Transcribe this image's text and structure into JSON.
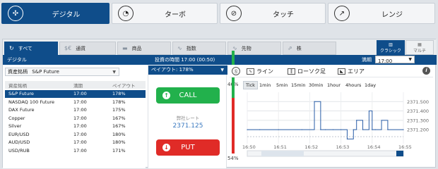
{
  "top_tabs": [
    {
      "label": "デジタル",
      "icon": "digital-icon",
      "active": true
    },
    {
      "label": "ターボ",
      "icon": "turbo-icon",
      "active": false
    },
    {
      "label": "タッチ",
      "icon": "touch-icon",
      "active": false
    },
    {
      "label": "レンジ",
      "icon": "range-icon",
      "active": false
    }
  ],
  "category_tabs": [
    {
      "label": "すべて",
      "icon": "refresh-icon",
      "active": true
    },
    {
      "label": "通貨",
      "icon": "currency-icon",
      "active": false
    },
    {
      "label": "商品",
      "icon": "commodity-icon",
      "active": false
    },
    {
      "label": "指数",
      "icon": "index-icon",
      "active": false
    },
    {
      "label": "先物",
      "icon": "futures-icon",
      "active": false
    },
    {
      "label": "株",
      "icon": "stock-icon",
      "active": false
    }
  ],
  "views": {
    "classic": "クラシック",
    "multi": "マルチ"
  },
  "header": {
    "title": "デジタル",
    "time": "投資の時間 17:00 (00:50)",
    "expiry_label": "満期",
    "expiry_value": "17:00"
  },
  "asset_select": {
    "label": "資産銘柄",
    "value": "S&P Future"
  },
  "list_headers": {
    "asset": "資産銘柄",
    "expiry": "満期",
    "payout": "ペイアウト"
  },
  "assets": [
    {
      "name": "S&P Future",
      "expiry": "17:00",
      "payout": "178%",
      "selected": true
    },
    {
      "name": "NASDAQ 100 Future",
      "expiry": "17:00",
      "payout": "178%",
      "selected": false
    },
    {
      "name": "DAX Future",
      "expiry": "17:00",
      "payout": "175%",
      "selected": false
    },
    {
      "name": "Copper",
      "expiry": "17:00",
      "payout": "167%",
      "selected": false
    },
    {
      "name": "Silver",
      "expiry": "17:00",
      "payout": "167%",
      "selected": false
    },
    {
      "name": "EUR/USD",
      "expiry": "17:00",
      "payout": "180%",
      "selected": false
    },
    {
      "name": "AUD/USD",
      "expiry": "17:00",
      "payout": "180%",
      "selected": false
    },
    {
      "name": "USD/RUB",
      "expiry": "17:00",
      "payout": "171%",
      "selected": false
    }
  ],
  "trade": {
    "payout": "ペイアウト: 178%",
    "call": "CALL",
    "put": "PUT",
    "rate_label": "弊社レート",
    "rate_value": "2371.125",
    "call_pct": "46%",
    "put_pct": "54%"
  },
  "chart_tools": {
    "line": "ライン",
    "candle": "ローソク足",
    "area": "エリア",
    "info": "i"
  },
  "intervals": [
    "Tick",
    "1min",
    "5min",
    "15min",
    "30min",
    "1hour",
    "4hours",
    "1day"
  ],
  "colors": {
    "brand": "#0f4d8a",
    "call": "#22b14c",
    "put": "#e02b27",
    "rate": "#3a79c0",
    "line": "#2a5ea8"
  },
  "chart_data": {
    "type": "line",
    "x": [
      "16:50",
      "16:50:30",
      "16:51",
      "16:51:30",
      "16:52",
      "16:52:10",
      "16:52:20",
      "16:52:30",
      "16:52:40",
      "16:53",
      "16:53:20",
      "16:53:30",
      "16:53:40",
      "16:54",
      "16:54:10",
      "16:54:20",
      "16:54:30",
      "16:54:40",
      "16:55"
    ],
    "values": [
      2371.2,
      2371.2,
      2371.2,
      2371.2,
      2371.5,
      2371.2,
      2371.2,
      2371.2,
      2371.2,
      2371.1,
      2371.2,
      2371.3,
      2371.2,
      2371.4,
      2371.2,
      2371.2,
      2371.3,
      2371.2,
      2371.2
    ],
    "xticks": [
      "16:50",
      "16:51",
      "16:52",
      "16:53",
      "16:54",
      "16:55"
    ],
    "yticks": [
      "2371.500",
      "2371.400",
      "2371.300",
      "2371.200"
    ],
    "ylim": [
      2371.05,
      2371.6
    ],
    "grid": true
  }
}
